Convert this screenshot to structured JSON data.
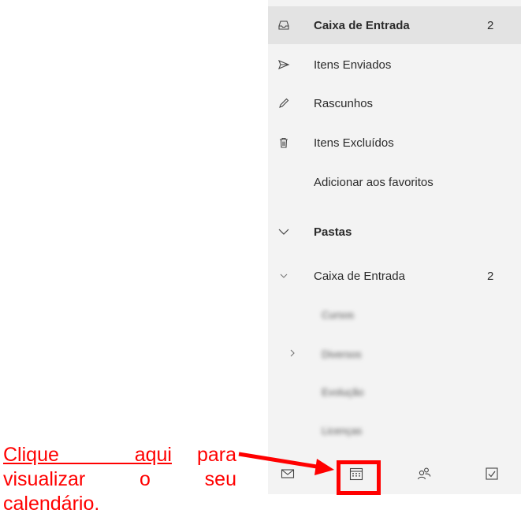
{
  "folders": {
    "favorites": [
      {
        "label": "Caixa de Entrada",
        "count": "2",
        "icon": "inbox-icon"
      },
      {
        "label": "Itens Enviados",
        "count": "",
        "icon": "send-icon"
      },
      {
        "label": "Rascunhos",
        "count": "",
        "icon": "pencil-icon"
      },
      {
        "label": "Itens Excluídos",
        "count": "",
        "icon": "trash-icon"
      }
    ],
    "add_favorites": "Adicionar aos favoritos",
    "folders_header": "Pastas",
    "inbox": {
      "label": "Caixa de Entrada",
      "count": "2"
    },
    "subfolders": [
      "Cursos",
      "Diversos",
      "Evolução",
      "Licenças"
    ]
  },
  "bottom_nav": [
    {
      "name": "mail",
      "icon": "mail-icon"
    },
    {
      "name": "calendar",
      "icon": "calendar-icon"
    },
    {
      "name": "people",
      "icon": "people-icon"
    },
    {
      "name": "tasks",
      "icon": "checkbox-icon"
    }
  ],
  "annotation": {
    "link_text": "Clique   aqui",
    "rest_text": "para visualizar   o   seu calendário."
  },
  "colors": {
    "highlight": "#ff0000",
    "panel": "#f3f3f3",
    "selected": "#e3e3e3"
  }
}
